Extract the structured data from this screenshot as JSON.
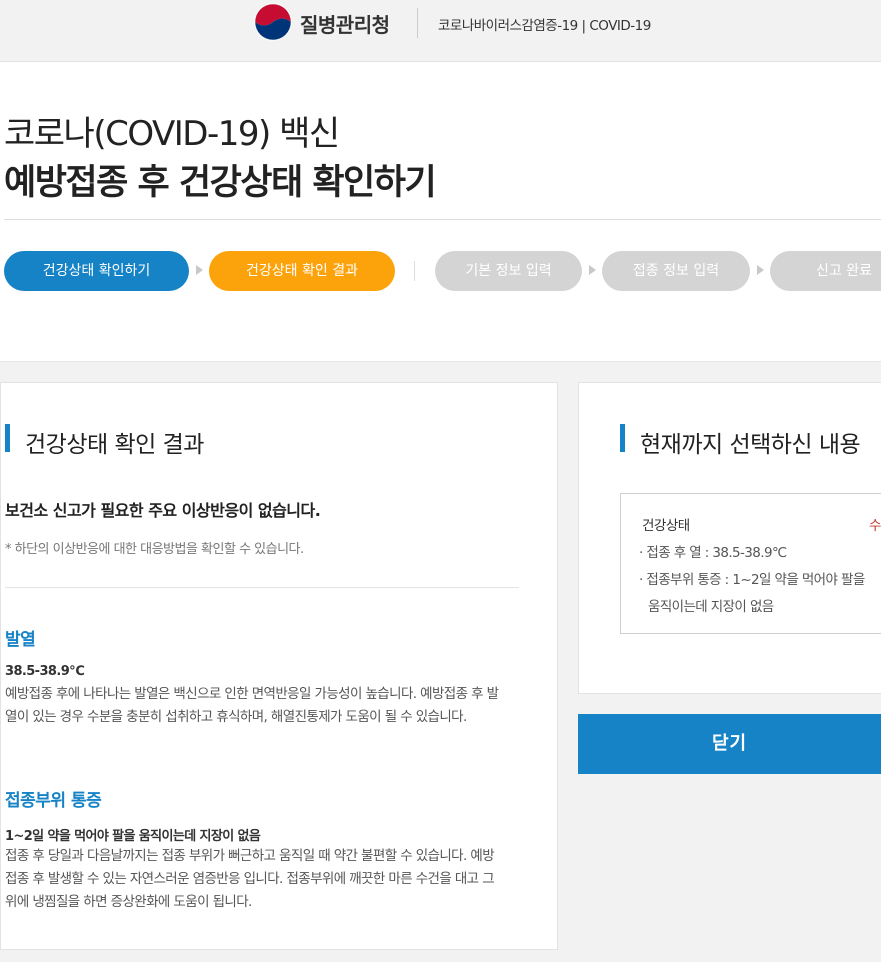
{
  "header": {
    "agency": "질병관리청",
    "subtitle": "코로나바이러스감염증-19 | COVID-19"
  },
  "title": {
    "line1": "코로나(COVID-19) 백신",
    "line2": "예방접종 후 건강상태 확인하기"
  },
  "steps": [
    {
      "label": "건강상태 확인하기",
      "state": "done"
    },
    {
      "label": "건강상태 확인 결과",
      "state": "current"
    },
    {
      "label": "기본 정보 입력",
      "state": "pending"
    },
    {
      "label": "접종 정보 입력",
      "state": "pending"
    },
    {
      "label": "신고 완료",
      "state": "pending"
    }
  ],
  "result": {
    "heading": "건강상태 확인 결과",
    "lead": "보건소 신고가 필요한 주요 이상반응이 없습니다.",
    "note": "* 하단의 이상반응에 대한 대응방법을 확인할 수 있습니다.",
    "symptoms": [
      {
        "name": "발열",
        "detail": "38.5-38.9℃",
        "description": "예방접종 후에 나타나는 발열은 백신으로 인한 면역반응일 가능성이 높습니다. 예방접종 후 발열이 있는 경우 수분을 충분히 섭취하고 휴식하며, 해열진통제가 도움이 될 수 있습니다."
      },
      {
        "name": "접종부위 통증",
        "detail": "1~2일 약을 먹어야 팔을 움직이는데 지장이 없음",
        "description": "접종 후 당일과 다음날까지는 접종 부위가 뻐근하고 움직일 때 약간 불편할 수 있습니다. 예방접종 후 발생할 수 있는 자연스러운 염증반응 입니다. 접종부위에 깨끗한 마른 수건을 대고 그 위에 냉찜질을 하면 증상완화에 도움이 됩니다."
      }
    ]
  },
  "summary": {
    "heading": "현재까지 선택하신 내용",
    "box_label": "건강상태",
    "edit_label": "수정",
    "items": [
      "· 접종 후 열 : 38.5-38.9℃",
      "· 접종부위 통증 : 1~2일 약을 먹어야 팔을",
      "움직이는데 지장이 없음"
    ]
  },
  "close_button": "닫기",
  "colors": {
    "primary": "#1583c6",
    "current_step": "#fca30c",
    "pending_step": "#d4d4d4"
  }
}
